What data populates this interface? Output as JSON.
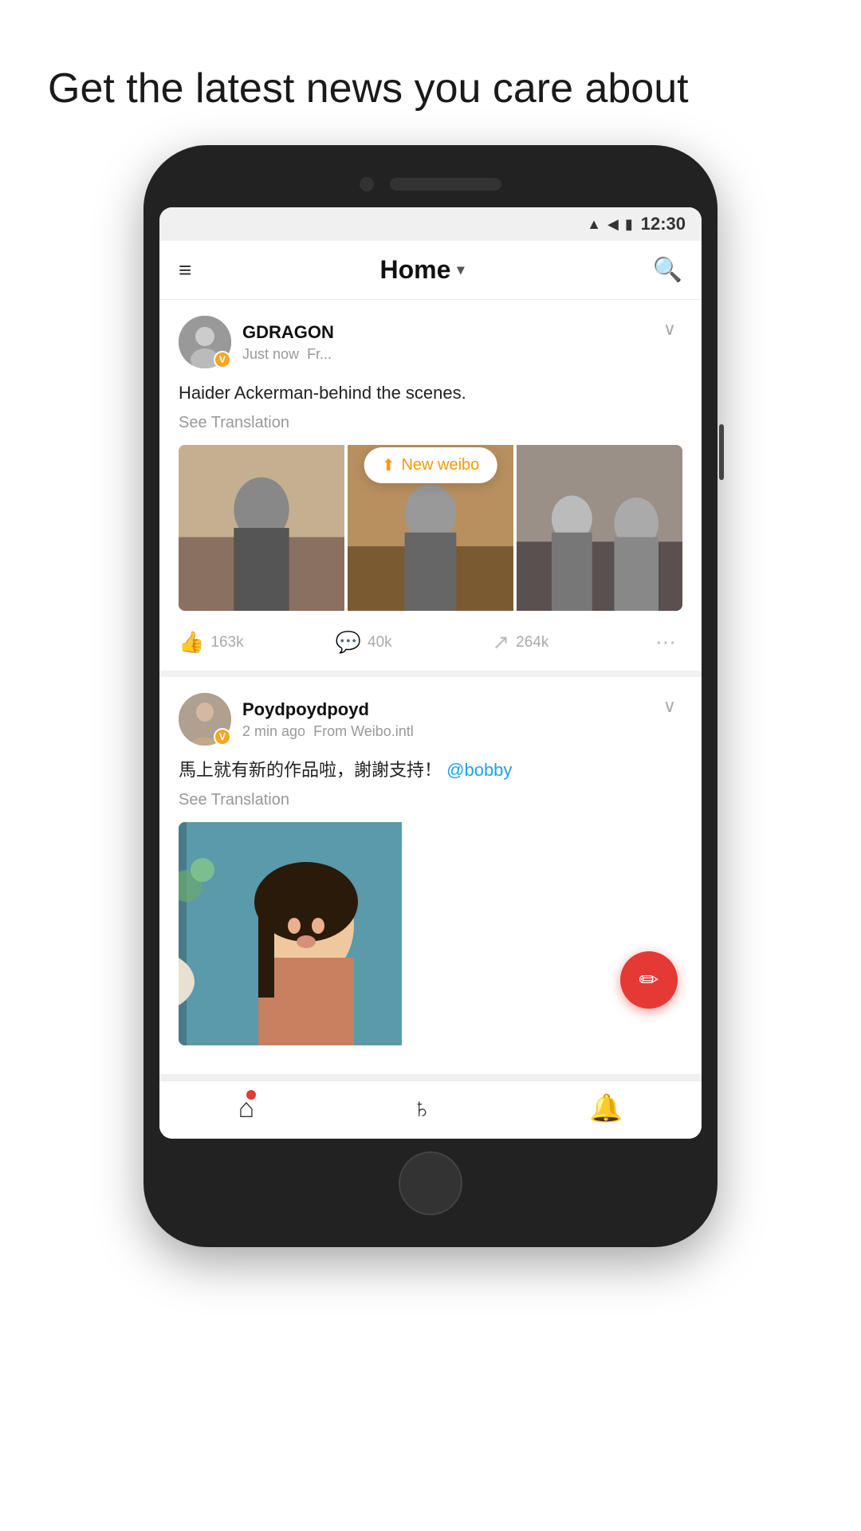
{
  "page": {
    "headline": "Get the latest news you care about"
  },
  "status_bar": {
    "time": "12:30"
  },
  "header": {
    "title": "Home",
    "dropdown_symbol": "▾",
    "hamburger": "≡",
    "search": "🔍"
  },
  "new_weibo_badge": {
    "text": "New weibo",
    "arrow": "⬆"
  },
  "posts": [
    {
      "id": "post1",
      "username": "GDRAGON",
      "time": "Just now",
      "source": "Fr...",
      "content": "Haider Ackerman-behind the scenes.",
      "see_translation": "See Translation",
      "likes": "163k",
      "comments": "40k",
      "reposts": "264k",
      "has_images": true,
      "image_count": 3
    },
    {
      "id": "post2",
      "username": "Poydpoydpoyd",
      "time": "2 min ago",
      "source": "From Weibo.intl",
      "content": "馬上就有新的作品啦，謝謝支持！",
      "mention": "@bobby",
      "see_translation": "See Translation",
      "has_images": true,
      "image_count": 1
    }
  ],
  "bottom_nav": {
    "items": [
      {
        "icon": "home",
        "label": "home",
        "has_dot": true
      },
      {
        "icon": "explore",
        "label": "explore",
        "has_dot": false
      },
      {
        "icon": "notification",
        "label": "notification",
        "has_dot": false
      }
    ]
  },
  "fab": {
    "icon": "✏"
  }
}
